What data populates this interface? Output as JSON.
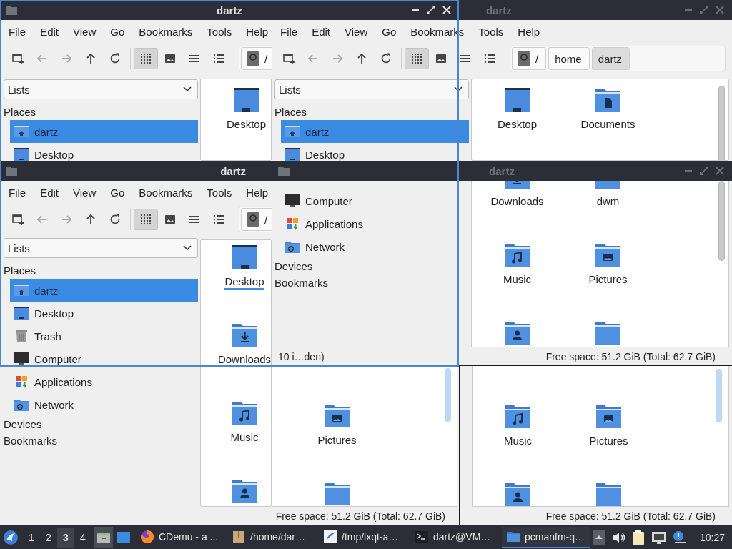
{
  "title_bars": [
    {
      "title": "dartz",
      "active": true,
      "app_icon": true,
      "controls": true
    },
    {
      "title": "dartz",
      "active": false,
      "app_icon": false,
      "controls": true
    },
    {
      "title": "dartz",
      "active": true,
      "app_icon": true,
      "controls": false
    },
    {
      "title": "dartz",
      "active": false,
      "app_icon": true,
      "controls": true
    }
  ],
  "panes": [
    {
      "menu": [
        "File",
        "Edit",
        "View",
        "Go",
        "Bookmarks",
        "Tools",
        "Help"
      ],
      "toolbar": {
        "nav": [
          {
            "kind": "new-tab",
            "disabled": false
          },
          {
            "kind": "back",
            "disabled": true
          },
          {
            "kind": "forward",
            "disabled": true
          },
          {
            "kind": "up",
            "disabled": false
          },
          {
            "kind": "reload",
            "disabled": false
          }
        ],
        "views": [
          {
            "kind": "icons",
            "selected": true
          },
          {
            "kind": "thumbnails",
            "selected": false
          },
          {
            "kind": "compact",
            "selected": false
          },
          {
            "kind": "detailed",
            "selected": false
          }
        ],
        "path": [
          {
            "label": "/",
            "kind": "root",
            "selected": false
          }
        ]
      },
      "sidebar": {
        "combo": "Lists",
        "sections": [
          {
            "title": "Places",
            "items": [
              {
                "label": "dartz",
                "kind": "home",
                "selected": true
              },
              {
                "label": "Desktop",
                "kind": "desktop",
                "selected": false
              }
            ]
          }
        ]
      },
      "files": [
        {
          "label": "Desktop",
          "kind": "desktop",
          "focused": false
        }
      ]
    },
    {
      "menu": [
        "File",
        "Edit",
        "View",
        "Go",
        "Bookmarks",
        "Tools",
        "Help"
      ],
      "toolbar": {
        "nav": [
          {
            "kind": "new-tab",
            "disabled": false
          },
          {
            "kind": "back",
            "disabled": true
          },
          {
            "kind": "forward",
            "disabled": true
          },
          {
            "kind": "up",
            "disabled": false
          },
          {
            "kind": "reload",
            "disabled": false
          }
        ],
        "views": [
          {
            "kind": "icons",
            "selected": true
          },
          {
            "kind": "thumbnails",
            "selected": false
          },
          {
            "kind": "compact",
            "selected": false
          },
          {
            "kind": "detailed",
            "selected": false
          }
        ],
        "path": [
          {
            "label": "/",
            "kind": "root",
            "selected": false
          },
          {
            "label": "home",
            "kind": "dir",
            "selected": false
          },
          {
            "label": "dartz",
            "kind": "dir",
            "selected": true
          }
        ]
      },
      "sidebar": {
        "combo": "Lists",
        "sections": [
          {
            "title": "Places",
            "items": [
              {
                "label": "dartz",
                "kind": "home",
                "selected": true
              },
              {
                "label": "Desktop",
                "kind": "desktop",
                "selected": false
              }
            ]
          }
        ]
      },
      "files": [
        {
          "label": "Desktop",
          "kind": "desktop",
          "focused": false
        },
        {
          "label": "Documents",
          "kind": "documents",
          "focused": false
        }
      ]
    },
    {
      "menu": [
        "File",
        "Edit",
        "View",
        "Go",
        "Bookmarks",
        "Tools",
        "Help"
      ],
      "toolbar": {
        "nav": [
          {
            "kind": "new-tab",
            "disabled": false
          },
          {
            "kind": "back",
            "disabled": true
          },
          {
            "kind": "forward",
            "disabled": true
          },
          {
            "kind": "up",
            "disabled": false
          },
          {
            "kind": "reload",
            "disabled": false
          }
        ],
        "views": [
          {
            "kind": "icons",
            "selected": true
          },
          {
            "kind": "thumbnails",
            "selected": false
          },
          {
            "kind": "compact",
            "selected": false
          },
          {
            "kind": "detailed",
            "selected": false
          }
        ],
        "path": [
          {
            "label": "/",
            "kind": "root",
            "selected": false
          }
        ]
      },
      "sidebar": {
        "combo": "Lists",
        "sections": [
          {
            "title": "Places",
            "items": [
              {
                "label": "dartz",
                "kind": "home",
                "selected": true
              },
              {
                "label": "Desktop",
                "kind": "desktop",
                "selected": false
              },
              {
                "label": "Trash",
                "kind": "trash",
                "selected": false
              },
              {
                "label": "Computer",
                "kind": "computer",
                "selected": false
              },
              {
                "label": "Applications",
                "kind": "applications",
                "selected": false
              },
              {
                "label": "Network",
                "kind": "network",
                "selected": false
              }
            ]
          },
          {
            "title": "Devices"
          },
          {
            "title": "Bookmarks"
          }
        ]
      },
      "files": [
        {
          "label": "Desktop",
          "kind": "desktop",
          "focused": true
        },
        {
          "label": "Downloads",
          "kind": "downloads",
          "focused": false
        },
        {
          "label": "Music",
          "kind": "music",
          "focused": false
        },
        {
          "kind": "public",
          "focused": false
        }
      ]
    },
    {
      "sidebar": {
        "sections": [
          {
            "items": [
              {
                "label": "Computer",
                "kind": "computer",
                "selected": false
              },
              {
                "label": "Applications",
                "kind": "applications",
                "selected": false
              },
              {
                "label": "Network",
                "kind": "network",
                "selected": false
              }
            ]
          },
          {
            "title": "Devices"
          },
          {
            "title": "Bookmarks"
          }
        ]
      },
      "files": [
        {
          "label": "Downloads",
          "kind": "downloads",
          "focused": false
        },
        {
          "label": "dwm",
          "kind": "folder",
          "focused": false
        },
        {
          "label": "Music",
          "kind": "music",
          "focused": false
        },
        {
          "label": "Pictures",
          "kind": "pictures",
          "focused": false
        },
        {
          "kind": "public",
          "focused": false
        },
        {
          "kind": "folder",
          "focused": false
        }
      ],
      "sidebar_status": "10 i…den)",
      "status": "Free space: 51.2 GiB (Total: 62.7 GiB)"
    },
    {
      "files": [
        {
          "label": "Pictures",
          "kind": "pictures",
          "focused": false
        },
        {
          "kind": "folder",
          "focused": false
        }
      ],
      "status": "Free space: 51.2 GiB (Total: 62.7 GiB)"
    },
    {
      "files": [
        {
          "label": "Music",
          "kind": "music",
          "focused": false
        },
        {
          "label": "Pictures",
          "kind": "pictures",
          "focused": false
        },
        {
          "kind": "public",
          "focused": false
        },
        {
          "kind": "folder",
          "focused": false
        }
      ],
      "status": "Free space: 51.2 GiB (Total: 62.7 GiB)"
    }
  ],
  "taskbar": {
    "workspaces": [
      {
        "label": "1",
        "selected": false
      },
      {
        "label": "2",
        "selected": false
      },
      {
        "label": "3",
        "selected": true
      },
      {
        "label": "4",
        "selected": false
      }
    ],
    "tasks": [
      {
        "label": "CDemu - a ...",
        "kind": "browser",
        "selected": false
      },
      {
        "label": "/home/dar…",
        "kind": "archive",
        "selected": false
      },
      {
        "label": "/tmp/lxqt-a…",
        "kind": "editor",
        "selected": false
      },
      {
        "label": "dartz@VM…",
        "kind": "terminal",
        "selected": false
      },
      {
        "label": "pcmanfm-q…",
        "kind": "filemanager",
        "selected": true
      }
    ],
    "clock": "10:27"
  }
}
